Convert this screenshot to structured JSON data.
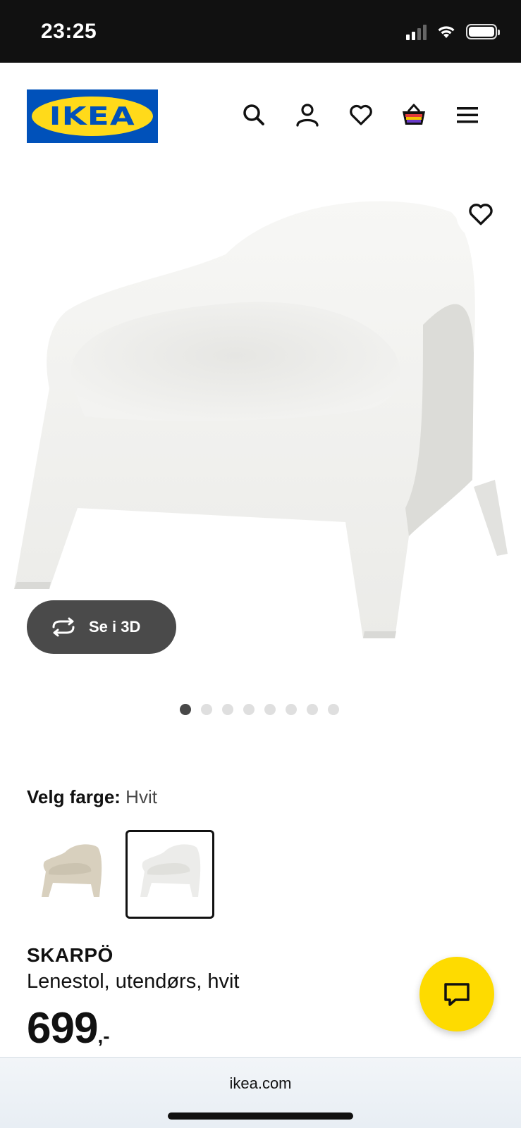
{
  "status_bar": {
    "time": "23:25"
  },
  "header": {
    "logo_text": "IKEA",
    "icons": [
      "search-icon",
      "account-icon",
      "favourites-icon",
      "shopping-bag-icon",
      "menu-icon"
    ]
  },
  "gallery": {
    "view_3d_label": "Se i 3D",
    "image_count": 8,
    "current_image": 1
  },
  "color_selector": {
    "label": "Velg farge:",
    "selected_value": "Hvit",
    "options": [
      {
        "color": "#d8d0be",
        "selected": false
      },
      {
        "color": "#ececea",
        "selected": true
      }
    ]
  },
  "product": {
    "name": "SKARPÖ",
    "description": "Lenestol, utendørs, hvit",
    "price_main": "699",
    "price_suffix": ",-"
  },
  "browser": {
    "url": "ikea.com"
  },
  "colors": {
    "ikea_blue": "#0051ba",
    "ikea_yellow": "#ffda1a",
    "chat_button": "#fedb00"
  }
}
